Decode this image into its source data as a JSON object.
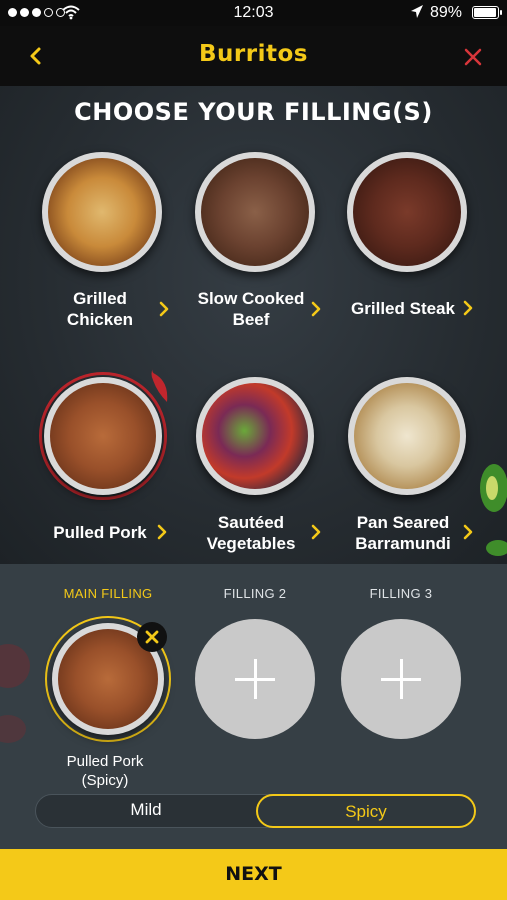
{
  "status_bar": {
    "time": "12:03",
    "battery": "89%",
    "signal_icon": "signal-dots-icon",
    "wifi_icon": "wifi-icon",
    "location_icon": "location-arrow-icon",
    "battery_icon": "battery-icon",
    "battery_level": 0.89
  },
  "navbar": {
    "title": "Burritos",
    "back_icon": "chevron-left-icon",
    "close_icon": "close-icon"
  },
  "heading": "CHOOSE YOUR FILLING(S)",
  "fillings": [
    {
      "line1": "Grilled",
      "line2": "Chicken",
      "food": "chicken"
    },
    {
      "line1": "Slow Cooked",
      "line2": "Beef",
      "food": "beef"
    },
    {
      "line1": "Grilled Steak",
      "line2": "",
      "food": "steak"
    },
    {
      "line1": "Pulled Pork",
      "line2": "",
      "food": "pork",
      "selected": true,
      "spicy": true
    },
    {
      "line1": "Sautéed",
      "line2": "Vegetables",
      "food": "vegetables"
    },
    {
      "line1": "Pan Seared",
      "line2": "Barramundi",
      "food": "barramundi"
    }
  ],
  "slots": {
    "main_label": "MAIN FILLING",
    "filling2_label": "FILLING 2",
    "filling3_label": "FILLING 3",
    "selected_line1": "Pulled Pork",
    "selected_line2": "(Spicy)",
    "add_icon": "plus-icon",
    "remove_icon": "close-x-icon"
  },
  "heat_toggle": {
    "options": [
      "Mild",
      "Spicy"
    ],
    "selected": "Spicy"
  },
  "next_label": "NEXT",
  "colors": {
    "accent": "#f4c918",
    "selected_ring": "#c0262d",
    "nav_bg": "#0e0e0e",
    "panel_bg": "#363f45"
  }
}
